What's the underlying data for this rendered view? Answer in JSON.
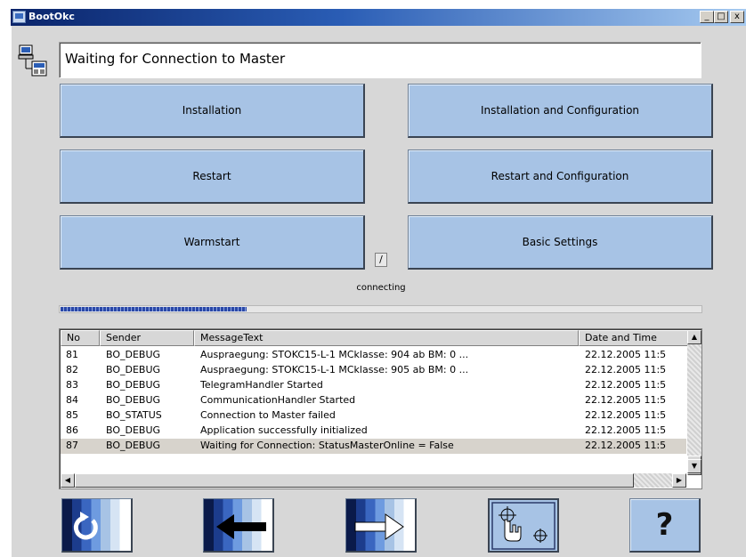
{
  "window": {
    "title": "BootOkc",
    "minimize_label": "_",
    "maximize_label": "□",
    "close_label": "x"
  },
  "status": {
    "message": "Waiting for Connection to Master"
  },
  "buttons": {
    "installation": "Installation",
    "installation_config": "Installation and Configuration",
    "restart": "Restart",
    "restart_config": "Restart and Configuration",
    "warmstart": "Warmstart",
    "basic_settings": "Basic Settings"
  },
  "spinner_glyph": "/",
  "connection_state": "connecting",
  "progress_percent": 29,
  "log": {
    "columns": [
      "No",
      "Sender",
      "MessageText",
      "Date and Time"
    ],
    "rows": [
      {
        "no": "81",
        "sender": "BO_DEBUG",
        "text": "Auspraegung: STOKC15-L-1 MCklasse: 904 ab BM: 0 ...",
        "date": "22.12.2005 11:5"
      },
      {
        "no": "82",
        "sender": "BO_DEBUG",
        "text": "Auspraegung: STOKC15-L-1 MCklasse: 905 ab BM: 0 ...",
        "date": "22.12.2005 11:5"
      },
      {
        "no": "83",
        "sender": "BO_DEBUG",
        "text": "TelegramHandler Started",
        "date": "22.12.2005 11:5"
      },
      {
        "no": "84",
        "sender": "BO_DEBUG",
        "text": "CommunicationHandler Started",
        "date": "22.12.2005 11:5"
      },
      {
        "no": "85",
        "sender": "BO_STATUS",
        "text": "Connection to Master failed",
        "date": "22.12.2005 11:5"
      },
      {
        "no": "86",
        "sender": "BO_DEBUG",
        "text": "Application successfully initialized",
        "date": "22.12.2005 11:5"
      },
      {
        "no": "87",
        "sender": "BO_DEBUG",
        "text": "Waiting for Connection: StatusMasterOnline = False",
        "date": "22.12.2005 11:5"
      }
    ],
    "selected_row": 6
  },
  "toolbar": {
    "help_label": "?",
    "icons": [
      "refresh-icon",
      "arrow-left-icon",
      "arrow-right-icon",
      "touch-target-icon",
      "help-icon"
    ]
  },
  "colors": {
    "button_face": "#a7c3e5",
    "title_bar": "#0a246a",
    "progress": "#2a48a8",
    "window_bg": "#d7d7d7"
  }
}
